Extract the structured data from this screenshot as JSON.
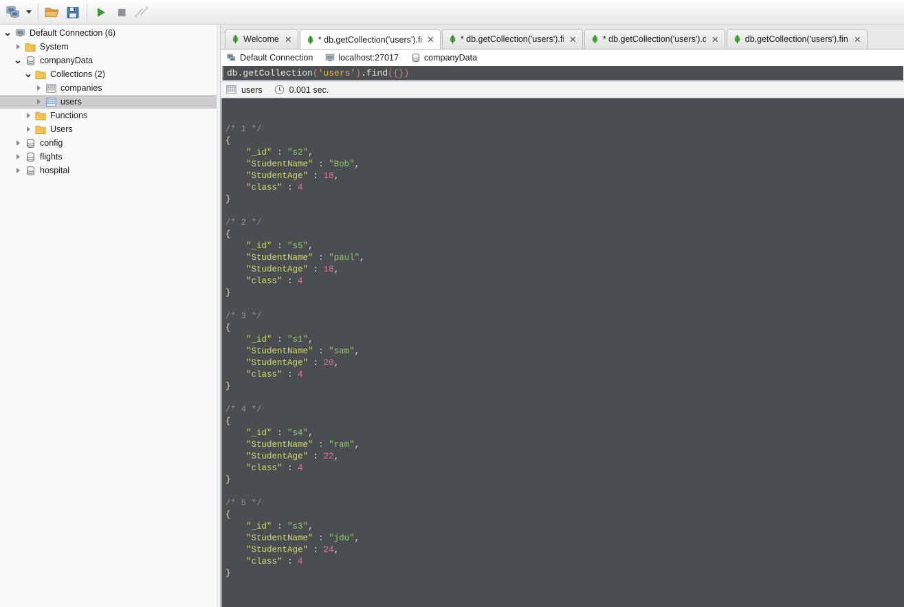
{
  "toolbar": {
    "buttons": [
      {
        "name": "connect-button",
        "icon": "computers-icon",
        "title": "Connect"
      },
      {
        "name": "connect-dropdown",
        "icon": "chevron-down-icon",
        "title": "Connect options"
      },
      {
        "name": "open-script-button",
        "icon": "folder-open-icon",
        "title": "Open Script"
      },
      {
        "name": "save-script-button",
        "icon": "floppy-save-icon",
        "title": "Save Script"
      },
      {
        "name": "execute-button",
        "icon": "play-icon",
        "title": "Execute"
      },
      {
        "name": "stop-button",
        "icon": "stop-square-icon",
        "title": "Stop"
      },
      {
        "name": "refresh-button",
        "icon": "rotate-icon",
        "title": "Refresh"
      }
    ]
  },
  "sidebar": {
    "items": [
      {
        "label": "Default Connection (6)",
        "icon": "computer-icon",
        "indent": 0,
        "twisty": "down",
        "selected": false
      },
      {
        "label": "System",
        "icon": "folder-icon",
        "indent": 1,
        "twisty": "right",
        "selected": false
      },
      {
        "label": "companyData",
        "icon": "database-icon",
        "indent": 1,
        "twisty": "down",
        "selected": false
      },
      {
        "label": "Collections (2)",
        "icon": "folder-icon",
        "indent": 2,
        "twisty": "down",
        "selected": false
      },
      {
        "label": "companies",
        "icon": "collection-icon",
        "indent": 3,
        "twisty": "right",
        "selected": false
      },
      {
        "label": "users",
        "icon": "collection-icon-active",
        "indent": 3,
        "twisty": "right",
        "selected": true
      },
      {
        "label": "Functions",
        "icon": "folder-icon",
        "indent": 2,
        "twisty": "right",
        "selected": false
      },
      {
        "label": "Users",
        "icon": "folder-icon",
        "indent": 2,
        "twisty": "right",
        "selected": false
      },
      {
        "label": "config",
        "icon": "database-icon",
        "indent": 1,
        "twisty": "right",
        "selected": false
      },
      {
        "label": "flights",
        "icon": "database-icon",
        "indent": 1,
        "twisty": "right",
        "selected": false
      },
      {
        "label": "hospital",
        "icon": "database-icon",
        "indent": 1,
        "twisty": "right",
        "selected": false
      }
    ]
  },
  "tabs": [
    {
      "label": "Welcome",
      "icon": "mongodb-leaf-icon",
      "active": false,
      "modified": false,
      "closable": true
    },
    {
      "label": "* db.getCollection('users').find...",
      "icon": "mongodb-leaf-icon",
      "active": true,
      "modified": true,
      "closable": true
    },
    {
      "label": "* db.getCollection('users').find...",
      "icon": "mongodb-leaf-icon",
      "active": false,
      "modified": true,
      "closable": true
    },
    {
      "label": "* db.getCollection('users').dele...",
      "icon": "mongodb-leaf-icon",
      "active": false,
      "modified": true,
      "closable": true
    },
    {
      "label": "db.getCollection('users').find({})",
      "icon": "mongodb-leaf-icon",
      "active": false,
      "modified": false,
      "closable": true
    }
  ],
  "breadcrumb": [
    {
      "label": "Default Connection",
      "icon": "computers-icon"
    },
    {
      "label": "localhost:27017",
      "icon": "computer-icon"
    },
    {
      "label": "companyData",
      "icon": "database-icon"
    }
  ],
  "query_editor": {
    "text": "db.getCollection('users').find({})",
    "parts": {
      "p1": "db.getCollection",
      "p2": "(",
      "p3": "'users'",
      "p4": ")",
      "p5": ".find",
      "p6": "({})"
    }
  },
  "result_header": {
    "collection": "users",
    "collection_icon": "collection-icon",
    "time_icon": "clock-icon",
    "time": "0.001 sec."
  },
  "results": {
    "documents": [
      {
        "index": "/* 1 */",
        "_id": "s2",
        "StudentName": "Bob",
        "StudentAge": 18,
        "class": 4
      },
      {
        "index": "/* 2 */",
        "_id": "s5",
        "StudentName": "paul",
        "StudentAge": 18,
        "class": 4
      },
      {
        "index": "/* 3 */",
        "_id": "s1",
        "StudentName": "sam",
        "StudentAge": 20,
        "class": 4
      },
      {
        "index": "/* 4 */",
        "_id": "s4",
        "StudentName": "ram",
        "StudentAge": 22,
        "class": 4
      },
      {
        "index": "/* 5 */",
        "_id": "s3",
        "StudentName": "jdu",
        "StudentAge": 24,
        "class": 4
      }
    ],
    "keys": {
      "id": "\"_id\"",
      "name": "\"StudentName\"",
      "age": "\"StudentAge\"",
      "cls": "\"class\""
    },
    "open_brace": "{",
    "close_brace": "}"
  },
  "colors": {
    "editor_bg": "#4a4e51",
    "key": "#d2d66f",
    "string": "#93c572",
    "number": "#e8788a",
    "comment": "#8d9398",
    "selection": "#cdcdcd",
    "accent_green": "#4ba83d"
  }
}
